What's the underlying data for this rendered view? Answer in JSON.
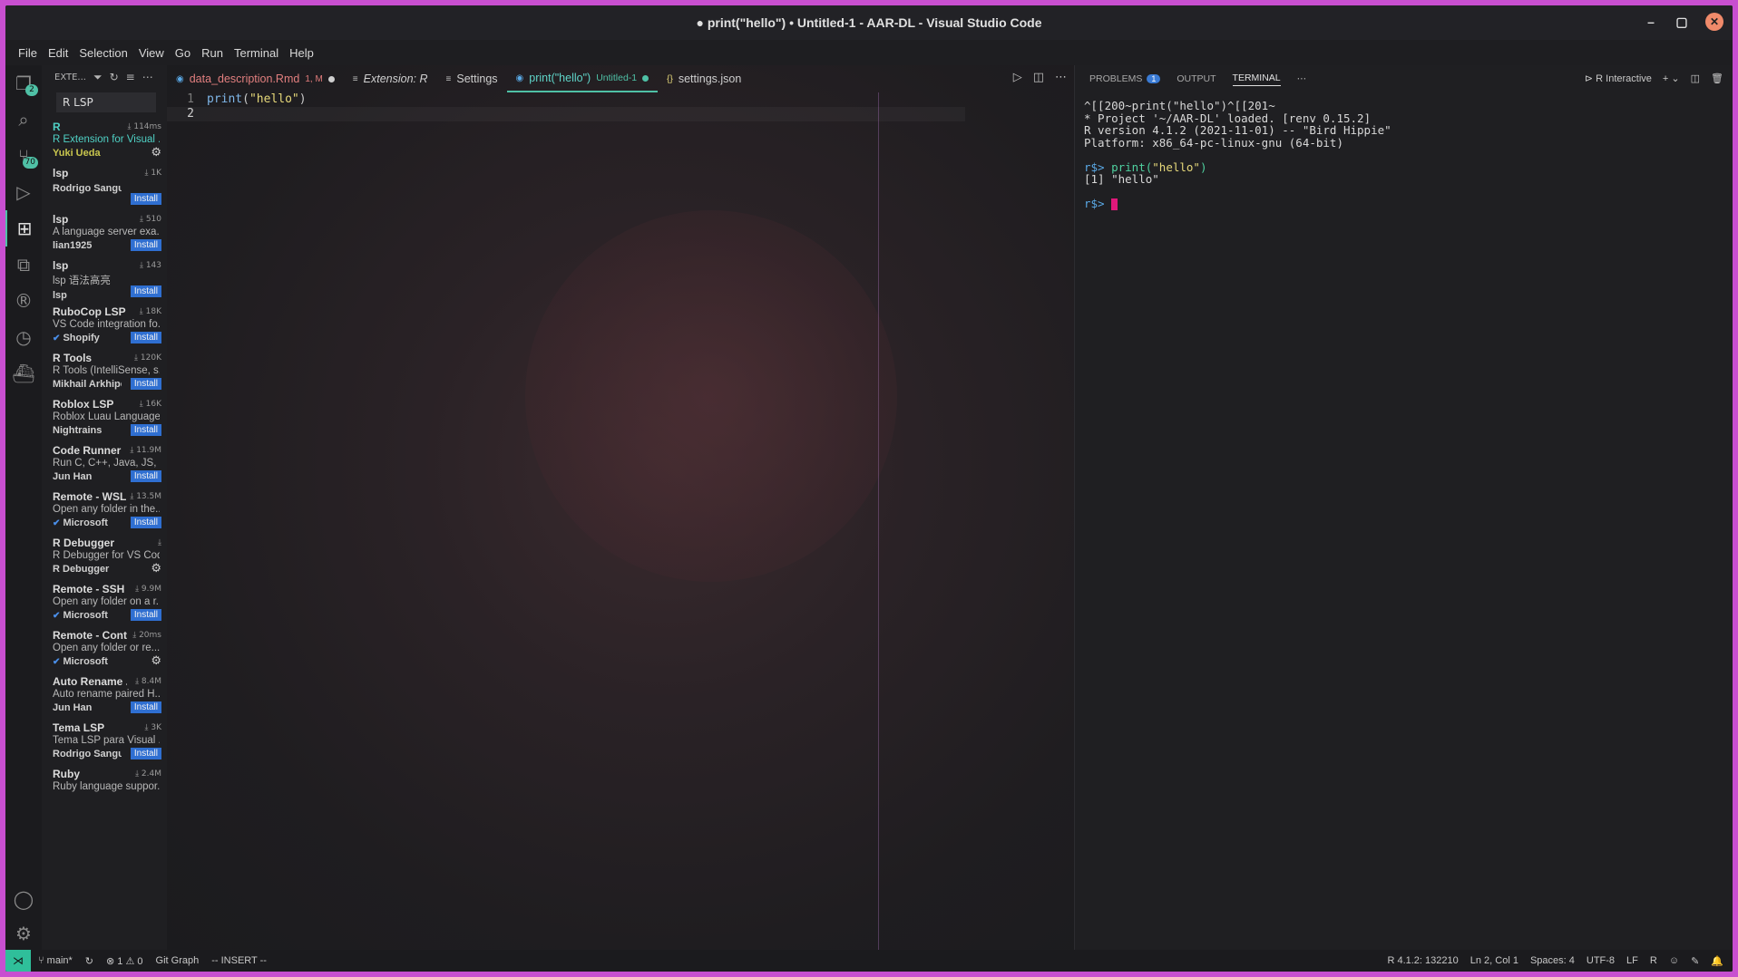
{
  "window": {
    "title": "● print(\"hello\") • Untitled-1 - AAR-DL - Visual Studio Code"
  },
  "menu": [
    "File",
    "Edit",
    "Selection",
    "View",
    "Go",
    "Run",
    "Terminal",
    "Help"
  ],
  "activity": {
    "scm_badge": "2",
    "git_badge": "70"
  },
  "sidebar": {
    "header": "EXTE...",
    "search_value": "R LSP",
    "extensions": [
      {
        "name": "R",
        "meta": "114ms",
        "desc": "R Extension for Visual ...",
        "publisher": "Yuki Ueda",
        "action": "gear"
      },
      {
        "name": "lsp",
        "meta": "1K",
        "desc": "",
        "publisher": "Rodrigo Sangu...",
        "action": "Install"
      },
      {
        "name": "lsp",
        "meta": "510",
        "desc": "A language server exa...",
        "publisher": "lian1925",
        "action": "Install"
      },
      {
        "name": "lsp",
        "meta": "143",
        "desc": "lsp 语法高亮",
        "publisher": "lsp",
        "action": "Install"
      },
      {
        "name": "RuboCop LSP",
        "meta": "18K",
        "desc": "VS Code integration fo...",
        "publisher": "Shopify",
        "action": "Install",
        "verified": true
      },
      {
        "name": "R Tools",
        "meta": "120K",
        "desc": "R Tools (IntelliSense, s...",
        "publisher": "Mikhail Arkhipov",
        "action": "Install"
      },
      {
        "name": "Roblox LSP",
        "meta": "16K",
        "desc": "Roblox Luau Language...",
        "publisher": "Nightrains",
        "action": "Install"
      },
      {
        "name": "Code Runner",
        "meta": "11.9M",
        "desc": "Run C, C++, Java, JS, PH...",
        "publisher": "Jun Han",
        "action": "Install"
      },
      {
        "name": "Remote - WSL",
        "meta": "13.5M",
        "desc": "Open any folder in the...",
        "publisher": "Microsoft",
        "action": "Install",
        "verified": true
      },
      {
        "name": "R Debugger",
        "meta": "",
        "desc": "R Debugger for VS Code",
        "publisher": "R Debugger",
        "action": "gear"
      },
      {
        "name": "Remote - SSH",
        "meta": "9.9M",
        "desc": "Open any folder on a r...",
        "publisher": "Microsoft",
        "action": "Install",
        "verified": true
      },
      {
        "name": "Remote - Cont...",
        "meta": "20ms",
        "desc": "Open any folder or re...",
        "publisher": "Microsoft",
        "action": "gear",
        "verified": true
      },
      {
        "name": "Auto Rename ...",
        "meta": "8.4M",
        "desc": "Auto rename paired H...",
        "publisher": "Jun Han",
        "action": "Install"
      },
      {
        "name": "Tema LSP",
        "meta": "3K",
        "desc": "Tema LSP para Visual ...",
        "publisher": "Rodrigo Sangu...",
        "action": "Install"
      },
      {
        "name": "Ruby",
        "meta": "2.4M",
        "desc": "Ruby language suppor...",
        "publisher": "",
        "action": ""
      }
    ]
  },
  "tabs": [
    {
      "label": "data_description.Rmd",
      "suffix": "1, M",
      "dot": true
    },
    {
      "label": "Extension: R",
      "suffix": "",
      "dot": false
    },
    {
      "label": "Settings",
      "suffix": "",
      "dot": false
    },
    {
      "label": "print(\"hello\")",
      "suffix": "Untitled-1",
      "dot": true
    },
    {
      "label": "settings.json",
      "suffix": "",
      "dot": false
    }
  ],
  "editor": {
    "lines": [
      {
        "n": "1",
        "fn": "print",
        "open": "(",
        "str": "\"hello\"",
        "close": ")"
      },
      {
        "n": "2",
        "fn": "",
        "open": "",
        "str": "",
        "close": ""
      }
    ]
  },
  "panel": {
    "tabs": [
      "PROBLEMS",
      "OUTPUT",
      "TERMINAL"
    ],
    "problems_count": "1",
    "terminal_name": "R Interactive",
    "output_lines": [
      "^[[200~print(\"hello\")^[[201~",
      "* Project '~/AAR-DL' loaded. [renv 0.15.2]",
      "R version 4.1.2 (2021-11-01) -- \"Bird Hippie\"",
      "Platform: x86_64-pc-linux-gnu (64-bit)"
    ],
    "prompt": "r$>",
    "cmd_fn": "print(",
    "cmd_str": "\"hello\"",
    "cmd_close": ")",
    "result": "[1] \"hello\""
  },
  "status": {
    "branch": "main*",
    "errors": "1",
    "warnings": "0",
    "git_graph": "Git Graph",
    "mode": "-- INSERT --",
    "r_version": "R 4.1.2: 132210",
    "position": "Ln 2, Col 1",
    "spaces": "Spaces: 4",
    "encoding": "UTF-8",
    "eol": "LF",
    "language": "R"
  },
  "colors": {
    "accent": "#4fc1a6",
    "frame": "#c84fd0",
    "install": "#2f6fd1",
    "cursor": "#e0187a"
  }
}
